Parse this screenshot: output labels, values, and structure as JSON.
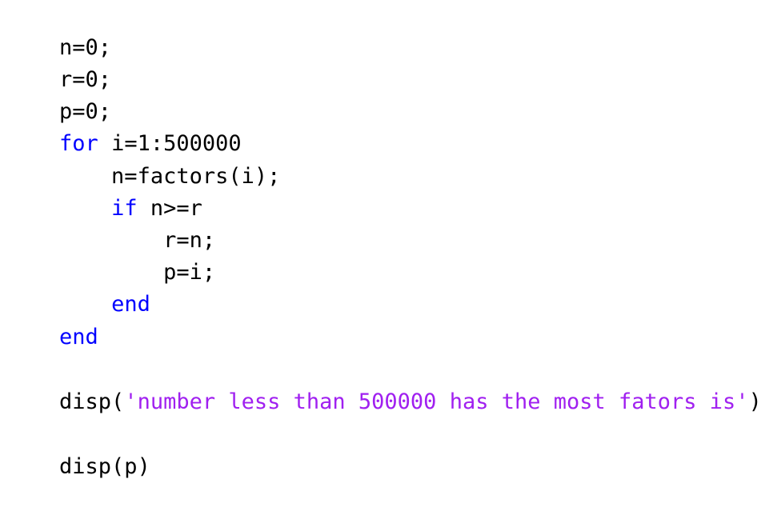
{
  "editor": {
    "lines": [
      [
        {
          "type": "plain",
          "text": "n=0;"
        }
      ],
      [
        {
          "type": "plain",
          "text": "r=0;"
        }
      ],
      [
        {
          "type": "plain",
          "text": "p=0;"
        }
      ],
      [
        {
          "type": "kw",
          "text": "for"
        },
        {
          "type": "plain",
          "text": " i=1:500000"
        }
      ],
      [
        {
          "type": "plain",
          "text": "    n=factors(i);"
        }
      ],
      [
        {
          "type": "plain",
          "text": "    "
        },
        {
          "type": "kw",
          "text": "if"
        },
        {
          "type": "plain",
          "text": " n>=r"
        }
      ],
      [
        {
          "type": "plain",
          "text": "        r=n;"
        }
      ],
      [
        {
          "type": "plain",
          "text": "        p=i;"
        }
      ],
      [
        {
          "type": "plain",
          "text": "    "
        },
        {
          "type": "kw",
          "text": "end"
        }
      ],
      [
        {
          "type": "kw",
          "text": "end"
        }
      ],
      [],
      [
        {
          "type": "plain",
          "text": "disp("
        },
        {
          "type": "str",
          "text": "'number less than 500000 has the most fators is'"
        },
        {
          "type": "plain",
          "text": ")"
        }
      ],
      [],
      [
        {
          "type": "plain",
          "text": "disp(p)"
        }
      ]
    ]
  },
  "colors": {
    "keyword": "#0000ff",
    "string": "#a020f0",
    "text": "#000000",
    "background": "#ffffff"
  }
}
